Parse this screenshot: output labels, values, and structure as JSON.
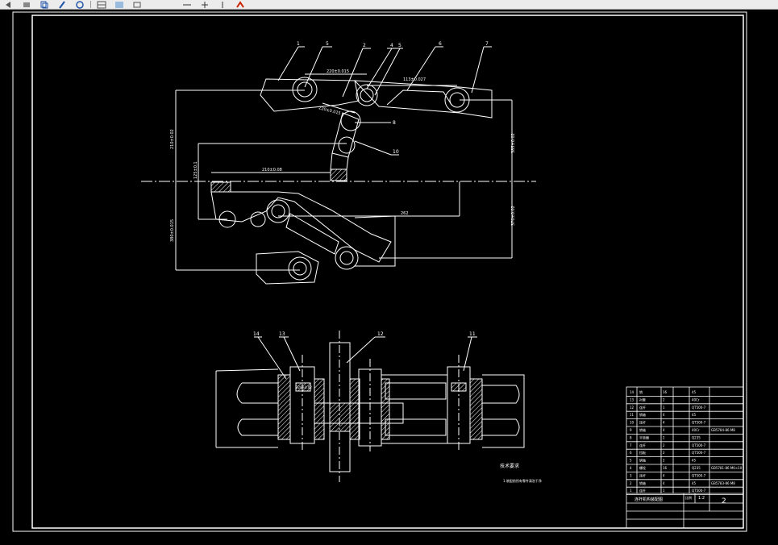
{
  "toolbar": {
    "icons": [
      "arrow-icon",
      "eraser-icon",
      "copy-icon",
      "pen-icon",
      "rotate-icon",
      "grid-icon",
      "image-icon",
      "rect-icon",
      "line-icon",
      "cross-icon",
      "pointer-icon",
      "redraw-icon"
    ]
  },
  "colors": {
    "background": "#000000",
    "lines": "#ffffff",
    "hatch": "#ffffff",
    "toolbar": "#ececec",
    "icon_red": "#cc2200",
    "icon_blue": "#2255aa"
  },
  "balloons_top": [
    "1",
    "5",
    "2",
    "4",
    "5",
    "6",
    "7"
  ],
  "balloons_side": [
    "8",
    "10"
  ],
  "balloons_bottom": [
    "14",
    "13",
    "12",
    "11"
  ],
  "dims": {
    "d1": "220±0.015",
    "d2": "113±0.027",
    "d3": "220±0.015",
    "d4": "210±0.02",
    "d5": "385±0.02",
    "d6": "380±0.015",
    "d7": "370±0.02",
    "d8": "262",
    "d9": "125±0.1",
    "d10": "210±0.08",
    "d11": "320±0.02"
  },
  "notes": {
    "title": "技术要求",
    "line1": "1.装配前所有零件清洗干净"
  },
  "parts_table": {
    "rows": [
      [
        "14",
        "销",
        "16",
        "45"
      ],
      [
        "13",
        "衬套",
        "2",
        "40Cr"
      ],
      [
        "12",
        "连杆",
        "1",
        "QT500-7"
      ],
      [
        "11",
        "销轴",
        "4",
        "45"
      ],
      [
        "10",
        "连杆",
        "4",
        "QT500-7"
      ],
      [
        "9",
        "销轴",
        "4",
        "40Cr"
      ],
      [
        "8",
        "平垫圈",
        "2",
        "Q235"
      ],
      [
        "7",
        "连杆",
        "2",
        "QT500-7"
      ],
      [
        "6",
        "挡板",
        "2",
        "QT500-7"
      ],
      [
        "5",
        "销轴",
        "2",
        "45"
      ],
      [
        "4",
        "螺栓",
        "16",
        "Q235"
      ],
      [
        "3",
        "连杆",
        "4",
        "QT500-7"
      ],
      [
        "2",
        "销轴",
        "4",
        "45"
      ],
      [
        "1",
        "连杆",
        "1",
        "QT500-7"
      ]
    ],
    "std_col": [
      "",
      "",
      "",
      "",
      "",
      "GB5784-86 M8",
      "",
      "",
      "",
      "",
      "GB5781-86 M6×10",
      "",
      "GB5783-86 M8",
      ""
    ],
    "title_name": "连杆机构装配图",
    "scale_label": "比例",
    "scale": "1:2",
    "sheet": "2"
  }
}
